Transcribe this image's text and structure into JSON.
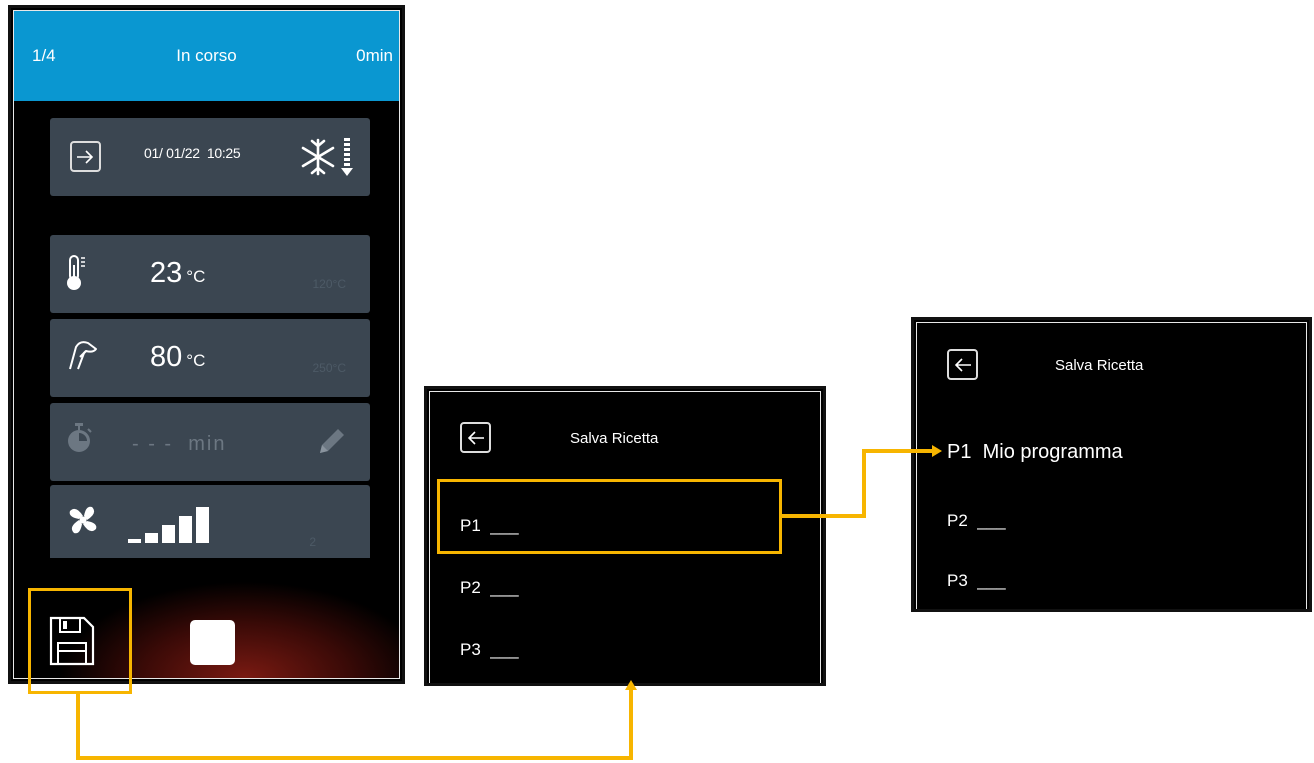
{
  "main_screen": {
    "header": {
      "step": "1/4",
      "status": "In corso",
      "time": "0min"
    },
    "date_card": {
      "date": "01/ 01/22",
      "time": "10:25",
      "icon": "snowflake-down-icon"
    },
    "temperature_card": {
      "value": "23",
      "unit": "°C",
      "setpoint": "120°C",
      "icon": "thermometer-icon"
    },
    "probe_card": {
      "value": "80",
      "unit": "°C",
      "setpoint": "250°C",
      "icon": "core-probe-icon"
    },
    "timer_card": {
      "value": "- - -",
      "unit": "min",
      "icon": "stopwatch-icon"
    },
    "fan_card": {
      "level": "2",
      "icon": "fan-icon"
    },
    "footer": {
      "save_icon": "floppy-disk-icon",
      "stop_icon": "stop-icon"
    }
  },
  "save_screen": {
    "title": "Salva Ricetta",
    "programs": [
      {
        "id": "P1",
        "name": "___"
      },
      {
        "id": "P2",
        "name": "___"
      },
      {
        "id": "P3",
        "name": "___"
      }
    ]
  },
  "saved_screen": {
    "title": "Salva Ricetta",
    "programs": [
      {
        "id": "P1",
        "name": "Mio programma"
      },
      {
        "id": "P2",
        "name": "___"
      },
      {
        "id": "P3",
        "name": "___"
      }
    ]
  },
  "colors": {
    "header_blue": "#0a97d1",
    "card_gray": "#3b4651",
    "highlight": "#f7b500"
  }
}
